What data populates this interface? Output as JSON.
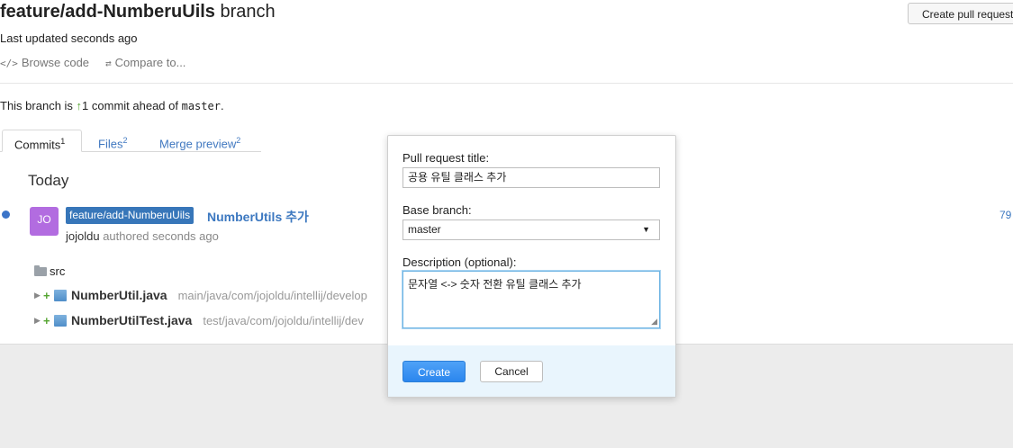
{
  "header": {
    "branch_name": "feature/add-NumberuUils",
    "branch_suffix": " branch",
    "create_pr_button": "Create pull request",
    "last_updated": "Last updated seconds ago",
    "browse_code": "Browse code",
    "compare_to": "Compare to...",
    "browse_icon": "</>",
    "compare_icon": "⇄"
  },
  "status": {
    "prefix": "This branch is ",
    "arrow": "↑",
    "count_text": "1 commit ahead of ",
    "base": "master",
    "suffix": "."
  },
  "tabs": [
    {
      "label": "Commits",
      "count": "1"
    },
    {
      "label": "Files",
      "count": "2"
    },
    {
      "label": "Merge preview",
      "count": "2"
    }
  ],
  "commits": {
    "group_label": "Today",
    "avatar_initials": "JO",
    "branch_badge": "feature/add-NumberuUils",
    "message": "NumberUtils 추가",
    "author": "jojoldu",
    "authored": " authored seconds ago",
    "sha_fragment": "79"
  },
  "files": {
    "folder": "src",
    "items": [
      {
        "name": "NumberUtil.java",
        "path": "main/java/com/jojoldu/intellij/develop"
      },
      {
        "name": "NumberUtilTest.java",
        "path": "test/java/com/jojoldu/intellij/dev"
      }
    ]
  },
  "dialog": {
    "title_label": "Pull request title:",
    "title_value": "공용 유틸 클래스 추가",
    "base_label": "Base branch:",
    "base_value": "master",
    "description_label": "Description (optional):",
    "description_value": "문자열 <-> 숫자 전환 유틸 클래스 추가",
    "create_button": "Create",
    "cancel_button": "Cancel"
  },
  "colors": {
    "accent": "#3c78c0",
    "badge": "#3776b9",
    "create_button": "#2b86ee",
    "dialog_footer": "#e9f5fd",
    "ahead_arrow": "#55a532"
  }
}
